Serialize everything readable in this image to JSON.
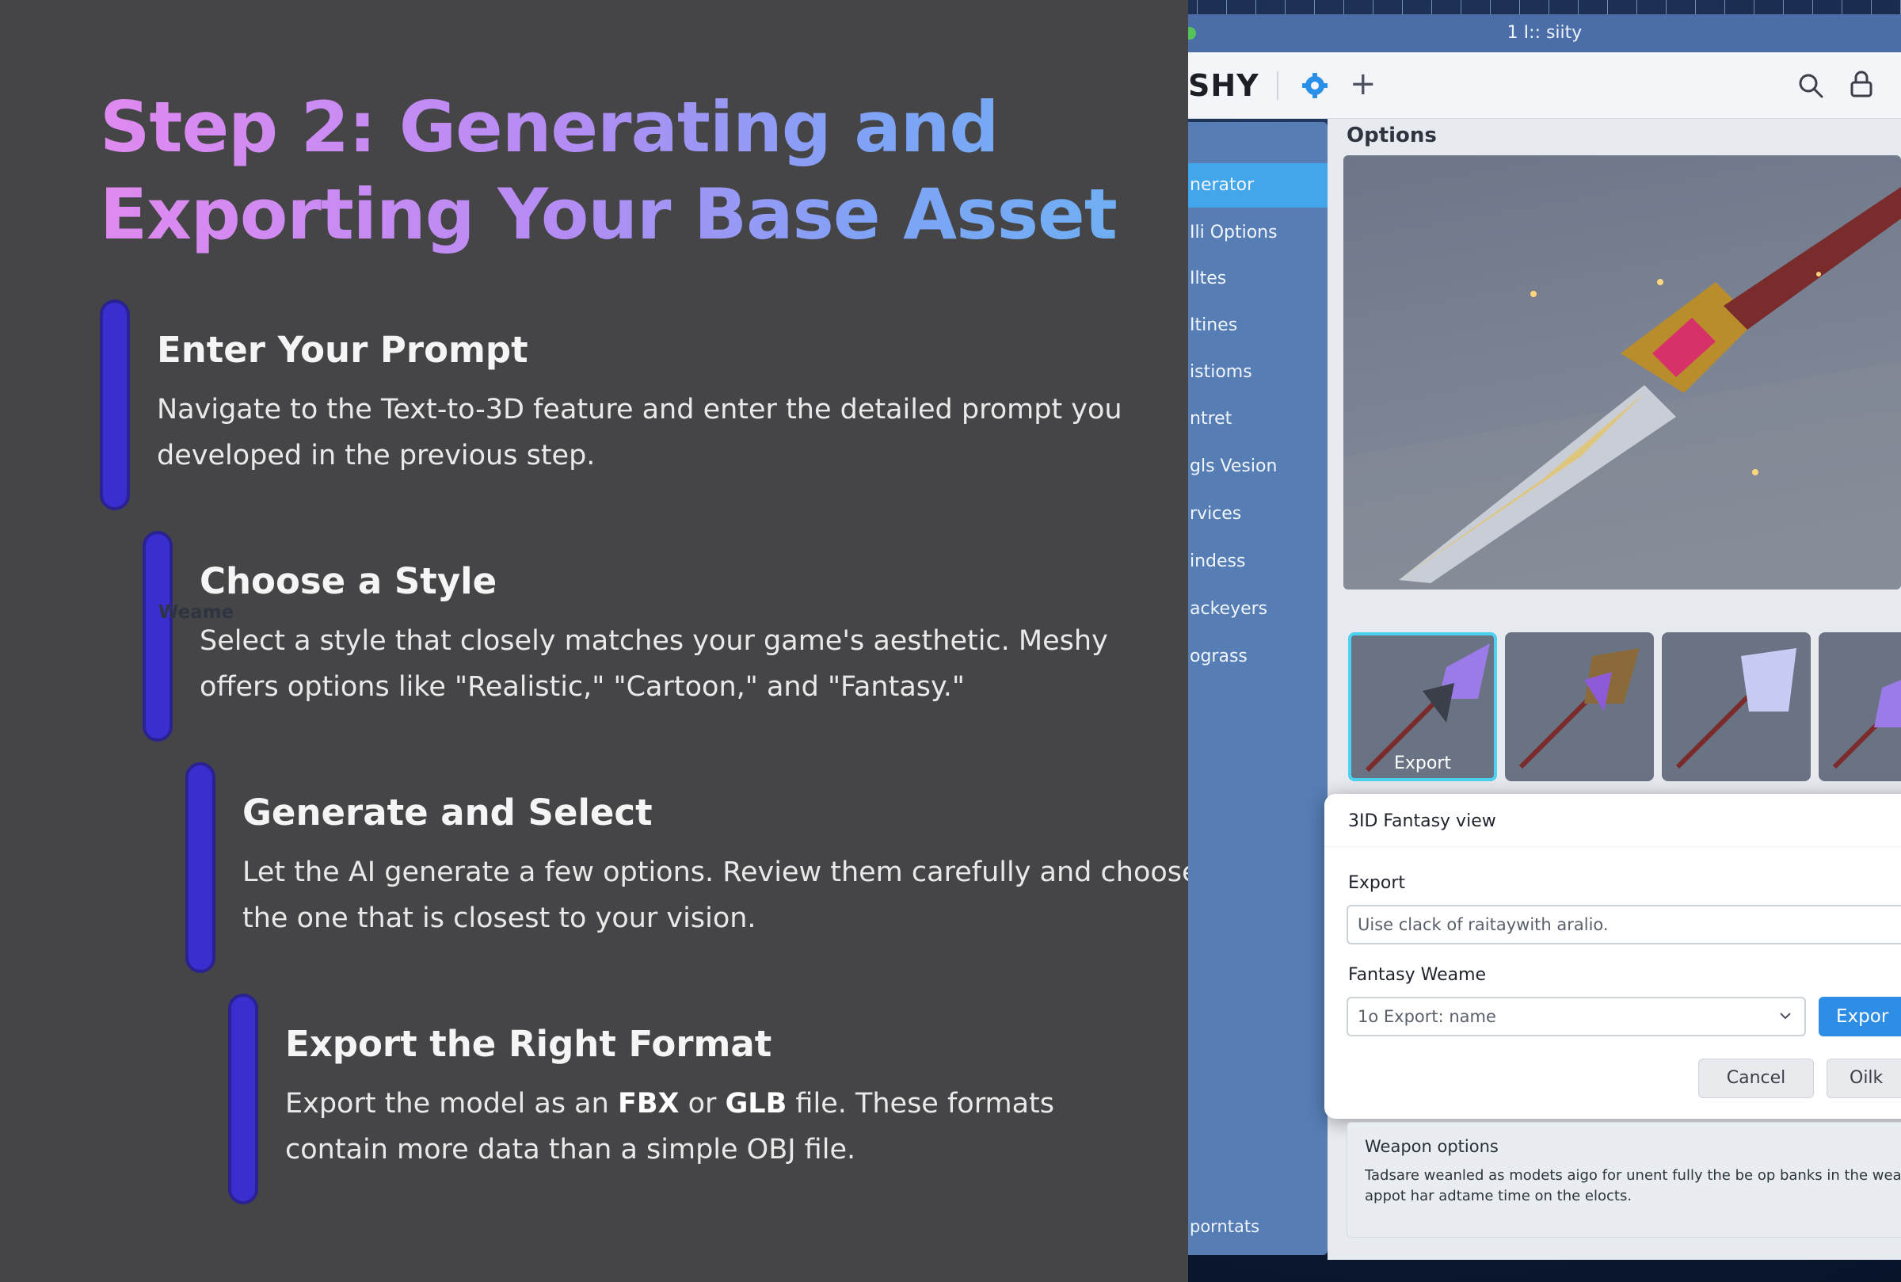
{
  "slide": {
    "title_line1": "Step 2: Generating and",
    "title_line2": "Exporting Your Base Asset",
    "steps": [
      {
        "title": "Enter Your Prompt",
        "body": "Navigate to the Text-to-3D feature and enter the detailed prompt you developed in the previous step."
      },
      {
        "title": "Choose a Style",
        "body": "Select a style that closely matches your game's aesthetic. Meshy offers options like \"Realistic,\" \"Cartoon,\" and \"Fantasy.\""
      },
      {
        "title": "Generate and Select",
        "body": "Let the AI generate a few options. Review them carefully and choose the one that is closest to your vision."
      },
      {
        "title": "Export the Right Format",
        "body_pre": "Export the model as an ",
        "bold1": "FBX",
        "body_mid": " or ",
        "bold2": "GLB",
        "body_post": " file. These formats contain more data than a simple OBJ file."
      }
    ],
    "accent_color": "#3a2ed0"
  },
  "app": {
    "window_title": "1 I:: siity",
    "logo": "SHY",
    "sidebar": [
      "nerator",
      "Ili Options",
      "Iltes",
      "Itines",
      "istioms",
      "ntret",
      "gls Vesion",
      "rvices",
      "indess",
      "ackeyers",
      "ograss"
    ],
    "sidebar_bottom": "porntats",
    "options_label": "Options",
    "weame_label": "Weame",
    "thumb_label": "Export",
    "dialog": {
      "title": "3ID Fantasy view",
      "export_label": "Export",
      "export_placeholder": "Uise clack of raitaywith aralio.",
      "fantasy_label": "Fantasy Weame",
      "select_value": "1o  Export: name",
      "export_button": "Expor",
      "cancel_button": "Cancel",
      "ok_button": "Oilk"
    },
    "weapon_options": {
      "title": "Weapon options",
      "line1": "Tadsare weanled as modets aigo for unent fully the be op banks in the wear",
      "line2": "appot har adtame time on the elocts."
    }
  }
}
